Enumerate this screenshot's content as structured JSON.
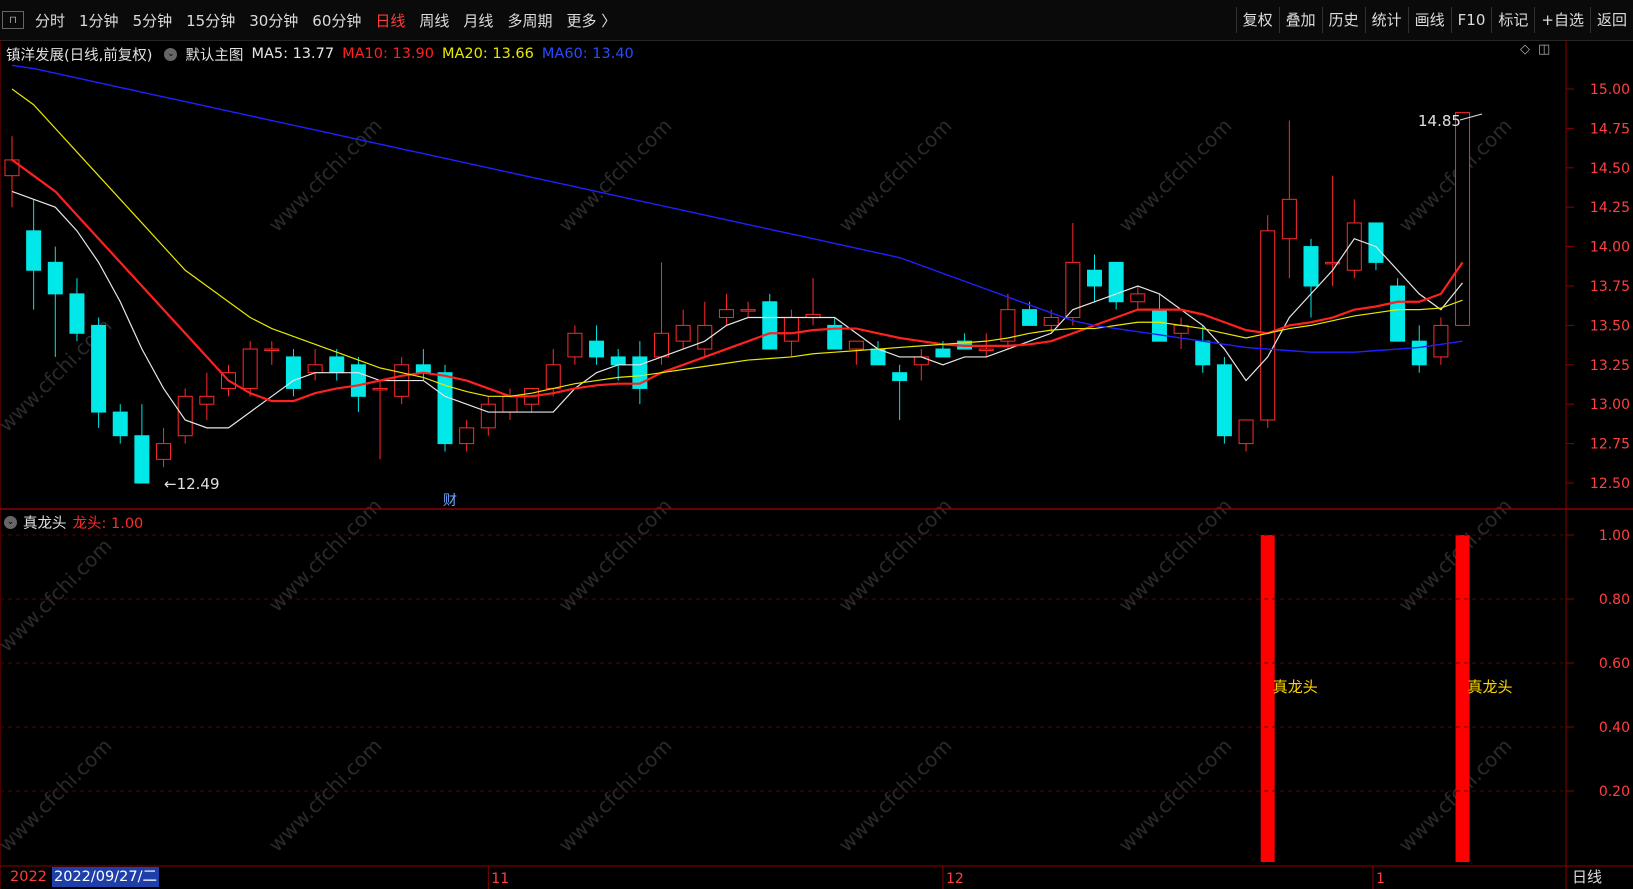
{
  "toolbar": {
    "corner_icon": "window-icon",
    "periods": [
      "分时",
      "1分钟",
      "5分钟",
      "15分钟",
      "30分钟",
      "60分钟",
      "日线",
      "周线",
      "月线",
      "多周期",
      "更多 〉"
    ],
    "active_period": "日线",
    "right_buttons": [
      "复权",
      "叠加",
      "历史",
      "统计",
      "画线",
      "F10",
      "标记",
      "+自选",
      "返回"
    ]
  },
  "main_info": {
    "stock": "镇洋发展(日线,前复权)",
    "template": "默认主图",
    "ma5": "MA5: 13.77",
    "ma10": "MA10: 13.90",
    "ma20": "MA20: 13.66",
    "ma60": "MA60: 13.40"
  },
  "sub_info": {
    "indicator": "真龙头",
    "value": "龙头: 1.00"
  },
  "colors": {
    "up": "#ff2a2a",
    "down": "#00e8e8",
    "ma5": "#e6e6e6",
    "ma10": "#ff2020",
    "ma20": "#e8e800",
    "ma60": "#2020ff",
    "frame": "#8b0000",
    "bar": "#ff0000",
    "label_yellow": "#ffd700"
  },
  "price_axis": {
    "ticks": [
      "15.00",
      "14.75",
      "14.50",
      "14.25",
      "14.00",
      "13.75",
      "13.50",
      "13.25",
      "13.00",
      "12.75",
      "12.50"
    ],
    "min": 12.4,
    "max": 15.1
  },
  "sub_axis": {
    "ticks": [
      "1.00",
      "0.80",
      "0.60",
      "0.40",
      "0.20"
    ]
  },
  "annotations": {
    "high_label": "14.85",
    "low_label": "←12.49",
    "finance_marker": "财",
    "signal_label": "真龙头",
    "watermark": "www.cfchi.com"
  },
  "time_axis": {
    "month_labels": [
      "11",
      "12",
      "1"
    ],
    "cursor_prefix": "2022",
    "cursor_date": "2022/09/27/二",
    "period_tag": "日线"
  },
  "chart_data": {
    "type": "candlestick",
    "ohlc": [
      [
        14.45,
        14.7,
        14.25,
        14.55
      ],
      [
        14.1,
        14.3,
        13.6,
        13.85
      ],
      [
        13.9,
        14.0,
        13.3,
        13.7
      ],
      [
        13.7,
        13.8,
        13.4,
        13.45
      ],
      [
        13.5,
        13.55,
        12.85,
        12.95
      ],
      [
        12.95,
        13.0,
        12.75,
        12.8
      ],
      [
        12.8,
        13.0,
        12.5,
        12.5
      ],
      [
        12.65,
        12.85,
        12.6,
        12.75
      ],
      [
        12.8,
        13.1,
        12.75,
        13.05
      ],
      [
        13.0,
        13.2,
        12.9,
        13.05
      ],
      [
        13.1,
        13.25,
        13.05,
        13.2
      ],
      [
        13.1,
        13.4,
        13.05,
        13.35
      ],
      [
        13.35,
        13.4,
        13.25,
        13.35
      ],
      [
        13.3,
        13.35,
        13.05,
        13.1
      ],
      [
        13.2,
        13.35,
        13.15,
        13.25
      ],
      [
        13.3,
        13.35,
        13.15,
        13.2
      ],
      [
        13.25,
        13.3,
        12.95,
        13.05
      ],
      [
        13.1,
        13.15,
        12.65,
        13.1
      ],
      [
        13.05,
        13.3,
        13.0,
        13.25
      ],
      [
        13.25,
        13.35,
        13.15,
        13.2
      ],
      [
        13.2,
        13.25,
        12.7,
        12.75
      ],
      [
        12.75,
        12.9,
        12.7,
        12.85
      ],
      [
        12.85,
        13.05,
        12.8,
        13.0
      ],
      [
        12.95,
        13.1,
        12.9,
        13.05
      ],
      [
        13.0,
        13.1,
        12.95,
        13.1
      ],
      [
        13.1,
        13.35,
        13.05,
        13.25
      ],
      [
        13.3,
        13.5,
        13.25,
        13.45
      ],
      [
        13.4,
        13.5,
        13.25,
        13.3
      ],
      [
        13.3,
        13.35,
        13.15,
        13.25
      ],
      [
        13.3,
        13.4,
        13.0,
        13.1
      ],
      [
        13.3,
        13.9,
        13.25,
        13.45
      ],
      [
        13.4,
        13.6,
        13.35,
        13.5
      ],
      [
        13.35,
        13.65,
        13.3,
        13.5
      ],
      [
        13.55,
        13.7,
        13.5,
        13.6
      ],
      [
        13.6,
        13.65,
        13.55,
        13.6
      ],
      [
        13.65,
        13.7,
        13.35,
        13.35
      ],
      [
        13.4,
        13.6,
        13.3,
        13.55
      ],
      [
        13.55,
        13.8,
        13.5,
        13.57
      ],
      [
        13.5,
        13.55,
        13.35,
        13.35
      ],
      [
        13.35,
        13.4,
        13.25,
        13.4
      ],
      [
        13.35,
        13.4,
        13.25,
        13.25
      ],
      [
        13.2,
        13.25,
        12.9,
        13.15
      ],
      [
        13.25,
        13.35,
        13.15,
        13.3
      ],
      [
        13.35,
        13.4,
        13.3,
        13.3
      ],
      [
        13.4,
        13.45,
        13.35,
        13.35
      ],
      [
        13.35,
        13.45,
        13.3,
        13.35
      ],
      [
        13.4,
        13.7,
        13.35,
        13.6
      ],
      [
        13.6,
        13.65,
        13.5,
        13.5
      ],
      [
        13.5,
        13.6,
        13.45,
        13.55
      ],
      [
        13.55,
        14.15,
        13.5,
        13.9
      ],
      [
        13.85,
        13.95,
        13.65,
        13.75
      ],
      [
        13.9,
        13.9,
        13.6,
        13.65
      ],
      [
        13.65,
        13.75,
        13.6,
        13.7
      ],
      [
        13.6,
        13.7,
        13.4,
        13.4
      ],
      [
        13.45,
        13.55,
        13.35,
        13.5
      ],
      [
        13.4,
        13.5,
        13.2,
        13.25
      ],
      [
        13.25,
        13.3,
        12.75,
        12.8
      ],
      [
        12.75,
        12.9,
        12.7,
        12.9
      ],
      [
        12.9,
        14.2,
        12.85,
        14.1
      ],
      [
        14.05,
        14.8,
        13.8,
        14.3
      ],
      [
        14.0,
        14.05,
        13.55,
        13.75
      ],
      [
        13.9,
        14.45,
        13.75,
        13.9
      ],
      [
        13.85,
        14.3,
        13.8,
        14.15
      ],
      [
        14.15,
        14.15,
        13.85,
        13.9
      ],
      [
        13.75,
        13.8,
        13.4,
        13.4
      ],
      [
        13.4,
        13.5,
        13.2,
        13.25
      ],
      [
        13.3,
        13.55,
        13.25,
        13.5
      ],
      [
        13.5,
        14.85,
        13.5,
        14.85
      ]
    ],
    "ma_series": [
      {
        "name": "MA5",
        "values": [
          14.35,
          14.3,
          14.25,
          14.1,
          13.9,
          13.65,
          13.35,
          13.1,
          12.9,
          12.85,
          12.85,
          12.95,
          13.05,
          13.15,
          13.2,
          13.2,
          13.2,
          13.15,
          13.15,
          13.15,
          13.05,
          13.0,
          12.95,
          12.95,
          12.95,
          12.95,
          13.1,
          13.2,
          13.25,
          13.25,
          13.3,
          13.35,
          13.4,
          13.5,
          13.55,
          13.55,
          13.55,
          13.55,
          13.55,
          13.45,
          13.35,
          13.3,
          13.3,
          13.25,
          13.3,
          13.3,
          13.35,
          13.4,
          13.45,
          13.6,
          13.65,
          13.7,
          13.75,
          13.7,
          13.6,
          13.5,
          13.35,
          13.15,
          13.3,
          13.55,
          13.7,
          13.85,
          14.05,
          14.0,
          13.85,
          13.7,
          13.6,
          13.77
        ]
      },
      {
        "name": "MA10",
        "values": [
          14.55,
          14.45,
          14.35,
          14.2,
          14.05,
          13.9,
          13.75,
          13.6,
          13.45,
          13.3,
          13.15,
          13.07,
          13.02,
          13.02,
          13.07,
          13.1,
          13.12,
          13.15,
          13.18,
          13.2,
          13.18,
          13.15,
          13.1,
          13.05,
          13.05,
          13.07,
          13.1,
          13.12,
          13.13,
          13.13,
          13.2,
          13.25,
          13.3,
          13.35,
          13.4,
          13.45,
          13.45,
          13.47,
          13.48,
          13.48,
          13.45,
          13.42,
          13.4,
          13.38,
          13.37,
          13.37,
          13.37,
          13.38,
          13.4,
          13.45,
          13.5,
          13.55,
          13.6,
          13.6,
          13.6,
          13.57,
          13.52,
          13.47,
          13.45,
          13.5,
          13.52,
          13.55,
          13.6,
          13.62,
          13.65,
          13.65,
          13.7,
          13.9
        ]
      },
      {
        "name": "MA20",
        "values": [
          15.0,
          14.9,
          14.75,
          14.6,
          14.45,
          14.3,
          14.15,
          14.0,
          13.85,
          13.75,
          13.65,
          13.55,
          13.48,
          13.43,
          13.38,
          13.33,
          13.28,
          13.23,
          13.2,
          13.17,
          13.12,
          13.08,
          13.05,
          13.05,
          13.07,
          13.1,
          13.13,
          13.15,
          13.17,
          13.18,
          13.2,
          13.22,
          13.24,
          13.26,
          13.28,
          13.29,
          13.3,
          13.32,
          13.33,
          13.34,
          13.35,
          13.36,
          13.37,
          13.38,
          13.39,
          13.4,
          13.42,
          13.45,
          13.47,
          13.48,
          13.48,
          13.5,
          13.52,
          13.52,
          13.5,
          13.48,
          13.45,
          13.42,
          13.45,
          13.48,
          13.5,
          13.53,
          13.56,
          13.58,
          13.6,
          13.6,
          13.61,
          13.66
        ]
      },
      {
        "name": "MA60",
        "values": [
          15.15,
          15.13,
          15.1,
          15.07,
          15.04,
          15.01,
          14.98,
          14.95,
          14.92,
          14.89,
          14.86,
          14.83,
          14.8,
          14.77,
          14.74,
          14.71,
          14.68,
          14.65,
          14.62,
          14.59,
          14.56,
          14.53,
          14.5,
          14.47,
          14.44,
          14.41,
          14.38,
          14.35,
          14.32,
          14.29,
          14.26,
          14.23,
          14.2,
          14.17,
          14.14,
          14.11,
          14.08,
          14.05,
          14.02,
          13.99,
          13.96,
          13.93,
          13.88,
          13.83,
          13.78,
          13.73,
          13.68,
          13.63,
          13.58,
          13.53,
          13.5,
          13.48,
          13.46,
          13.44,
          13.42,
          13.4,
          13.38,
          13.36,
          13.35,
          13.34,
          13.33,
          13.33,
          13.33,
          13.34,
          13.35,
          13.36,
          13.38,
          13.4
        ]
      }
    ],
    "signal": {
      "name": "龙头",
      "bars_at_index": [
        58,
        67
      ],
      "value": 1.0
    }
  }
}
